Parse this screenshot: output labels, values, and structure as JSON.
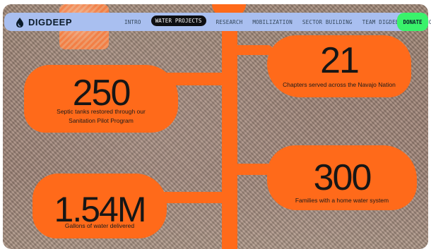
{
  "header": {
    "brand": "DIGDEEP",
    "nav_items": [
      {
        "label": "INTRO",
        "active": false
      },
      {
        "label": "WATER PROJECTS",
        "active": true
      },
      {
        "label": "RESEARCH",
        "active": false
      },
      {
        "label": "MOBILIZATION",
        "active": false
      },
      {
        "label": "SECTOR BUILDING",
        "active": false
      },
      {
        "label": "TEAM DIGDEEP",
        "active": false
      },
      {
        "label": "FINANCIALS",
        "active": false
      }
    ],
    "donate_label": "DONATE"
  },
  "stats": [
    {
      "value": "250",
      "description_lines": [
        "Septic tanks restored through our",
        "Sanitation Pilot Program"
      ]
    },
    {
      "value": "21",
      "description_lines": [
        "Chapters served across the Navajo Nation"
      ]
    },
    {
      "value": "300",
      "description_lines": [
        "Families with a home water system"
      ]
    },
    {
      "value": "1.54M",
      "description_lines": [
        "Gallons of water delivered"
      ]
    }
  ],
  "colors": {
    "nav_bg": "#a9bff0",
    "donate_bg": "#39f26b",
    "accent_orange": "#ff6a1a"
  }
}
